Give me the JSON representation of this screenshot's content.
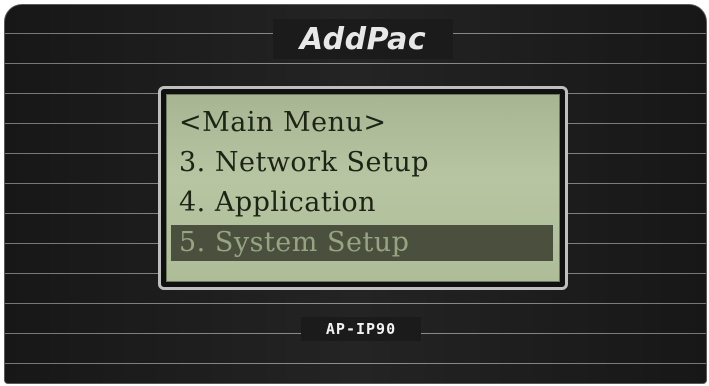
{
  "device": {
    "brand": "AddPac",
    "model": "AP-IP90"
  },
  "lcd": {
    "title": "<Main Menu>",
    "items": [
      {
        "label": "3. Network Setup",
        "selected": false
      },
      {
        "label": "4. Application",
        "selected": false
      },
      {
        "label": "5. System Setup",
        "selected": true
      }
    ]
  },
  "colors": {
    "lcd_background": "#b1bf9c",
    "lcd_text": "#1d2415",
    "selection_background": "#4a503d",
    "selection_text": "#96a482",
    "body": "#1b1b1b"
  }
}
